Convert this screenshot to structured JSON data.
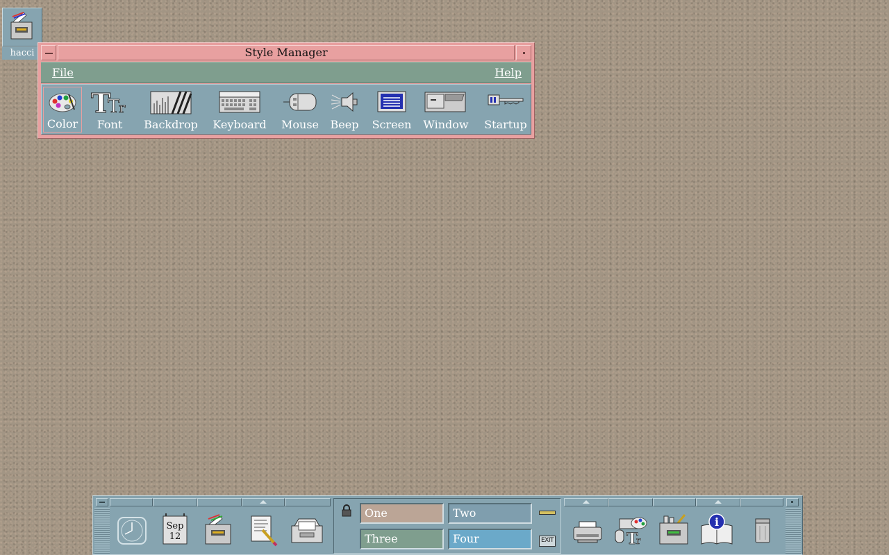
{
  "desktop": {
    "icon_label": "hacci"
  },
  "window": {
    "title": "Style Manager",
    "menus": {
      "file": "File",
      "help": "Help"
    },
    "tools": [
      {
        "label": "Color"
      },
      {
        "label": "Font"
      },
      {
        "label": "Backdrop"
      },
      {
        "label": "Keyboard"
      },
      {
        "label": "Mouse"
      },
      {
        "label": "Beep"
      },
      {
        "label": "Screen"
      },
      {
        "label": "Window"
      },
      {
        "label": "Startup"
      }
    ]
  },
  "front_panel": {
    "calendar": {
      "month": "Sep",
      "day": "12"
    },
    "workspaces": [
      {
        "label": "One",
        "color": "#bba596"
      },
      {
        "label": "Two",
        "color": "#7f9eae"
      },
      {
        "label": "Three",
        "color": "#7f9e8e"
      },
      {
        "label": "Four",
        "color": "#6ba9c9"
      }
    ],
    "exit_label": "EXIT",
    "icons": [
      "clock-icon",
      "calendar-icon",
      "file-manager-icon",
      "text-editor-icon",
      "mail-icon",
      "lock-icon",
      "busy-light",
      "exit-icon",
      "printer-icon",
      "style-manager-icon",
      "application-manager-icon",
      "help-icon",
      "trash-icon"
    ]
  },
  "colors": {
    "window_frame": "#e8a0a0",
    "menubar": "#7f9e8e",
    "panel": "#86a4b0",
    "desktop": "#a29584"
  }
}
